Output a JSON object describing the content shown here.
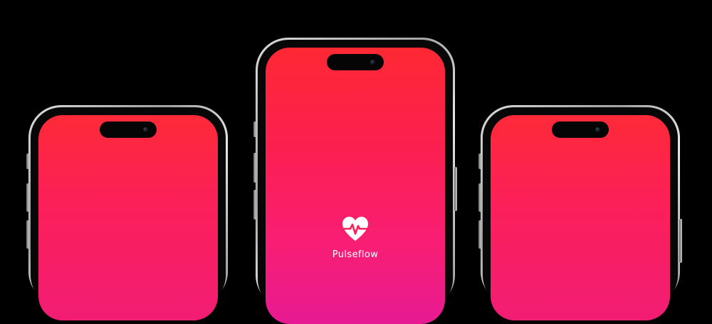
{
  "app": {
    "name": "Pulseflow",
    "logo_icon": "heart-pulse-icon"
  },
  "colors": {
    "background": "#000000",
    "gradient_top": "#fe2834",
    "gradient_mid": "#fb1f4f",
    "gradient_bottom": "#e61a92",
    "logo": "#ffffff"
  },
  "devices": [
    {
      "id": "left",
      "screen": "blank-gradient"
    },
    {
      "id": "center",
      "screen": "splash"
    },
    {
      "id": "right",
      "screen": "blank-gradient"
    }
  ]
}
